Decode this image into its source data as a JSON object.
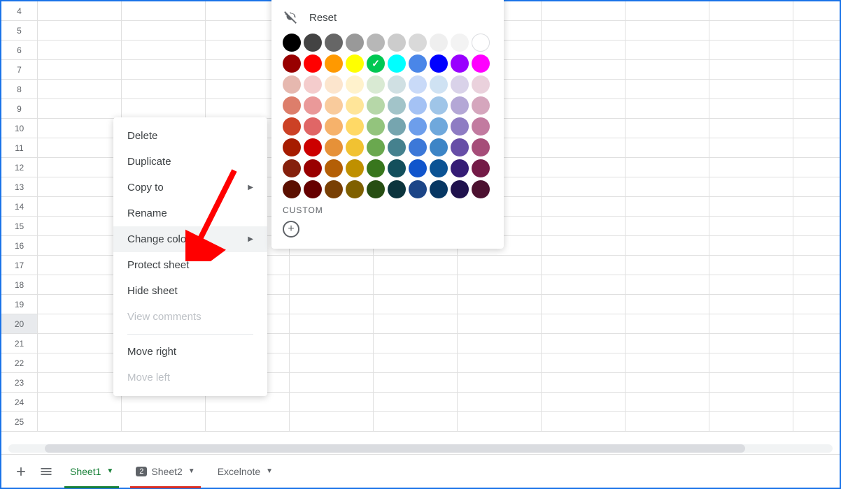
{
  "rows": [
    4,
    5,
    6,
    7,
    8,
    9,
    10,
    11,
    12,
    13,
    14,
    15,
    16,
    17,
    18,
    19,
    20,
    21,
    22,
    23,
    24,
    25
  ],
  "selectedRow": 20,
  "tabs": {
    "sheet1": "Sheet1",
    "sheet2": "Sheet2",
    "sheet2_badge": "2",
    "excelnote": "Excelnote"
  },
  "contextMenu": {
    "delete": "Delete",
    "duplicate": "Duplicate",
    "copy_to": "Copy to",
    "rename": "Rename",
    "change_color": "Change color",
    "protect_sheet": "Protect sheet",
    "hide_sheet": "Hide sheet",
    "view_comments": "View comments",
    "move_right": "Move right",
    "move_left": "Move left"
  },
  "colorPanel": {
    "reset": "Reset",
    "custom": "CUSTOM",
    "selectedColor": "#00c853",
    "rows": [
      [
        "#000000",
        "#434343",
        "#666666",
        "#999999",
        "#b7b7b7",
        "#cccccc",
        "#d9d9d9",
        "#efefef",
        "#f3f3f3",
        "#ffffff"
      ],
      [
        "#980000",
        "#ff0000",
        "#ff9900",
        "#ffff00",
        "#00c853",
        "#00ffff",
        "#4a86e8",
        "#0000ff",
        "#9900ff",
        "#ff00ff"
      ],
      [
        "#e6b8af",
        "#f4cccc",
        "#fce5cd",
        "#fff2cc",
        "#d9ead3",
        "#d0e0e3",
        "#c9daf8",
        "#cfe2f3",
        "#d9d2e9",
        "#ead1dc"
      ],
      [
        "#dd7e6b",
        "#ea9999",
        "#f9cb9c",
        "#ffe599",
        "#b6d7a8",
        "#a2c4c9",
        "#a4c2f4",
        "#9fc5e8",
        "#b4a7d6",
        "#d5a6bd"
      ],
      [
        "#cc4125",
        "#e06666",
        "#f6b26b",
        "#ffd966",
        "#93c47d",
        "#76a5af",
        "#6d9eeb",
        "#6fa8dc",
        "#8e7cc3",
        "#c27ba0"
      ],
      [
        "#a61c00",
        "#cc0000",
        "#e69138",
        "#f1c232",
        "#6aa84f",
        "#45818e",
        "#3c78d8",
        "#3d85c6",
        "#674ea7",
        "#a64d79"
      ],
      [
        "#85200c",
        "#990000",
        "#b45f06",
        "#bf9000",
        "#38761d",
        "#134f5c",
        "#1155cc",
        "#0b5394",
        "#351c75",
        "#741b47"
      ],
      [
        "#5b0f00",
        "#660000",
        "#783f04",
        "#7f6000",
        "#274e13",
        "#0c343d",
        "#1c4587",
        "#073763",
        "#20124d",
        "#4c1130"
      ]
    ]
  }
}
